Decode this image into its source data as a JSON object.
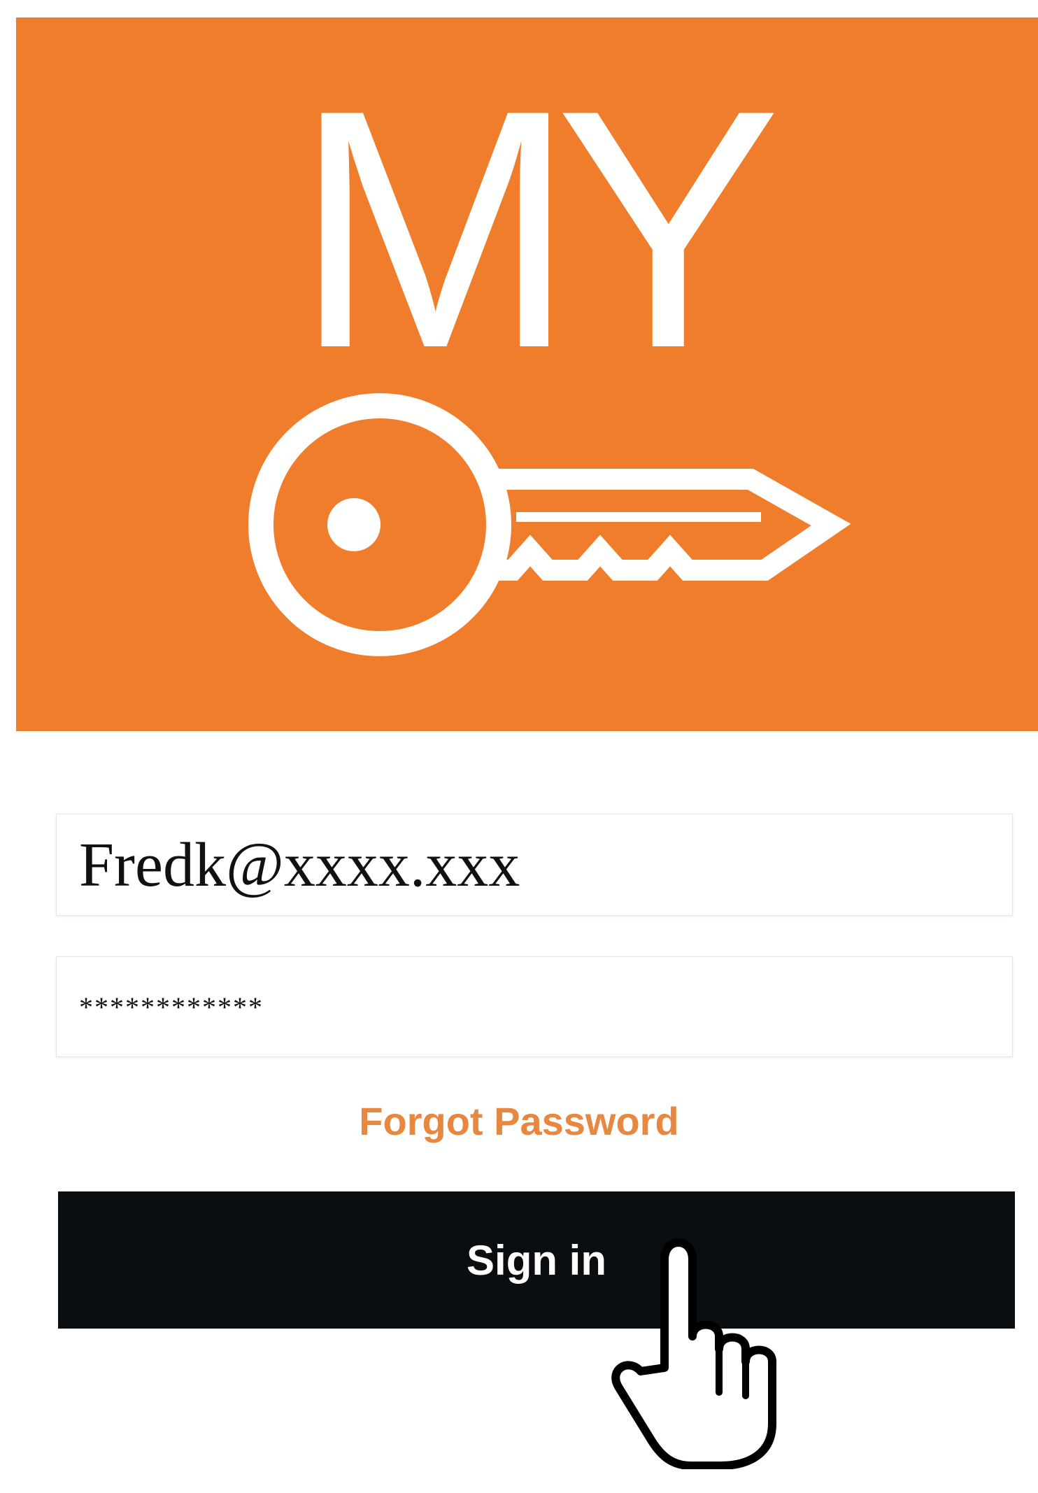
{
  "app": {
    "logo_text": "MY",
    "logo_icon": "key-icon"
  },
  "login": {
    "email_value": "Fredk@xxxx.xxx",
    "password_value": "************",
    "forgot_password_label": "Forgot Password",
    "sign_in_label": "Sign in"
  },
  "cursor": {
    "icon": "hand-pointer-icon"
  },
  "colors": {
    "brand_orange": "#F07D2B",
    "link_orange": "#E8873F",
    "button_black": "#0B0E11",
    "text_white": "#FFFFFF"
  }
}
